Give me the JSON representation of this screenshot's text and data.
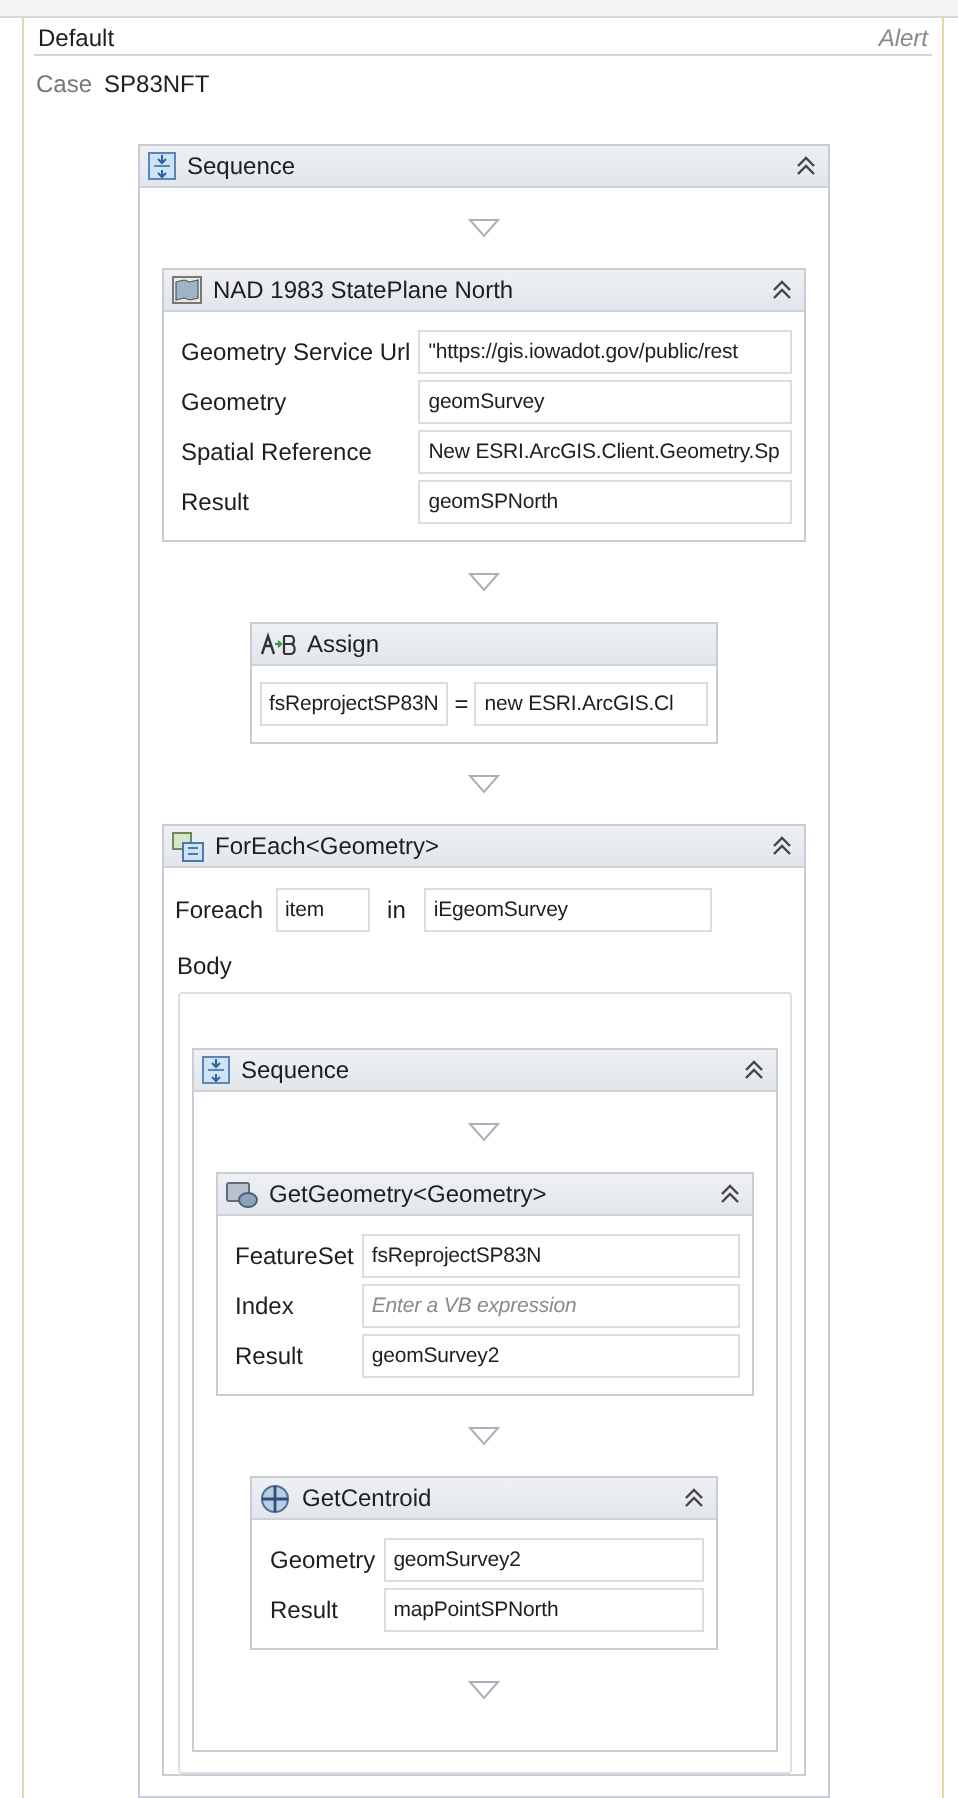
{
  "header": {
    "title": "Default",
    "tag": "Alert"
  },
  "case": {
    "label": "Case",
    "value": "SP83NFT"
  },
  "activity": {
    "kind": "sequence",
    "title": "Sequence",
    "expanded": true,
    "children": [
      {
        "kind": "project",
        "title": "NAD 1983 StatePlane North",
        "expanded": true,
        "properties": [
          {
            "label": "Geometry Service Url",
            "value": "\"https://gis.iowadot.gov/public/rest"
          },
          {
            "label": "Geometry",
            "value": "geomSurvey"
          },
          {
            "label": "Spatial Reference",
            "value": "New ESRI.ArcGIS.Client.Geometry.Sp"
          },
          {
            "label": "Result",
            "value": "geomSPNorth"
          }
        ]
      },
      {
        "kind": "assign",
        "title": "Assign",
        "to": "fsReprojectSP83N",
        "operator": "=",
        "value": "new ESRI.ArcGIS.Cl"
      },
      {
        "kind": "foreach",
        "title": "ForEach<Geometry>",
        "expanded": true,
        "foreach_label": "Foreach",
        "item": "item",
        "in_label": "in",
        "collection": "iEgeomSurvey",
        "body_label": "Body",
        "body": {
          "kind": "sequence",
          "title": "Sequence",
          "expanded": true,
          "children": [
            {
              "kind": "get-geometry",
              "title": "GetGeometry<Geometry>",
              "expanded": true,
              "properties": [
                {
                  "label": "FeatureSet",
                  "value": "fsReprojectSP83N"
                },
                {
                  "label": "Index",
                  "placeholder": "Enter a VB expression"
                },
                {
                  "label": "Result",
                  "value": "geomSurvey2"
                }
              ]
            },
            {
              "kind": "centroid",
              "title": "GetCentroid",
              "expanded": true,
              "properties": [
                {
                  "label": "Geometry",
                  "value": "geomSurvey2"
                },
                {
                  "label": "Result",
                  "value": "mapPointSPNorth"
                }
              ]
            }
          ]
        }
      }
    ]
  }
}
